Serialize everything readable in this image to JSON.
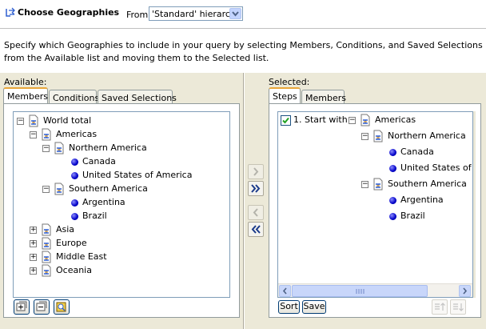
{
  "dialog": {
    "title": "Choose Geographies",
    "from_label": "From:",
    "hierarchy_value": "'Standard' hierarchy",
    "description": "Specify which Geographies to include in your query by selecting Members, Conditions, and Saved Selections from the Available list and moving them to the Selected list."
  },
  "available": {
    "label": "Available:",
    "tabs": [
      "Members",
      "Conditions",
      "Saved Selections"
    ],
    "active_tab": "Members",
    "tree": [
      {
        "label": "World total",
        "expanded": true,
        "type": "hierarchy"
      },
      {
        "label": "Americas",
        "expanded": true,
        "type": "hierarchy"
      },
      {
        "label": "Northern America",
        "expanded": true,
        "type": "hierarchy"
      },
      {
        "label": "Canada",
        "type": "member"
      },
      {
        "label": "United States of America",
        "type": "member"
      },
      {
        "label": "Southern America",
        "expanded": true,
        "type": "hierarchy"
      },
      {
        "label": "Argentina",
        "type": "member"
      },
      {
        "label": "Brazil",
        "type": "member"
      },
      {
        "label": "Asia",
        "expanded": false,
        "type": "hierarchy"
      },
      {
        "label": "Europe",
        "expanded": false,
        "type": "hierarchy"
      },
      {
        "label": "Middle East",
        "expanded": false,
        "type": "hierarchy"
      },
      {
        "label": "Oceania",
        "expanded": false,
        "type": "hierarchy"
      }
    ]
  },
  "selected": {
    "label": "Selected:",
    "tabs": [
      "Steps",
      "Members"
    ],
    "active_tab": "Steps",
    "step_label": "1. Start with",
    "step_checked": true,
    "tree": [
      {
        "label": "Americas",
        "expanded": true,
        "type": "hierarchy"
      },
      {
        "label": "Northern America",
        "expanded": true,
        "type": "hierarchy"
      },
      {
        "label": "Canada",
        "type": "member"
      },
      {
        "label": "United States of America",
        "type": "member"
      },
      {
        "label": "Southern America",
        "expanded": true,
        "type": "hierarchy"
      },
      {
        "label": "Argentina",
        "type": "member"
      },
      {
        "label": "Brazil",
        "type": "member"
      }
    ],
    "sort_label": "Sort",
    "save_label": "Save"
  },
  "icons": {
    "title": "hierarchy-icon",
    "move_right": "chevron-right-icon",
    "move_all_right": "double-chevron-right-icon",
    "move_left": "chevron-left-icon",
    "move_all_left": "double-chevron-left-icon"
  },
  "colors": {
    "tab_highlight": "#e8a63a",
    "panel_bg": "#ece9d8",
    "member_dot": "#0000c8",
    "accent": "#2f5fd0"
  }
}
